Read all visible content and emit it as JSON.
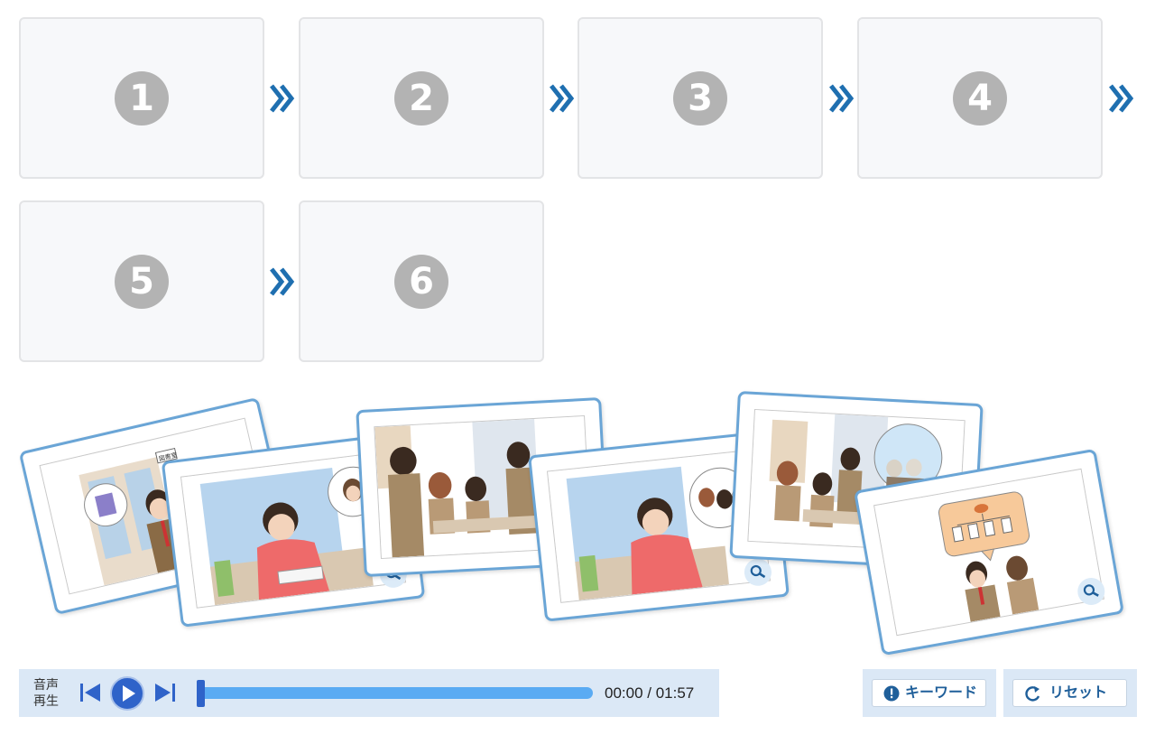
{
  "slots": [
    {
      "number": "1"
    },
    {
      "number": "2"
    },
    {
      "number": "3"
    },
    {
      "number": "4"
    },
    {
      "number": "5"
    },
    {
      "number": "6"
    }
  ],
  "colors": {
    "accent": "#1f6fb0",
    "card_border": "#6aa5d6",
    "player_bg": "#dbe8f6",
    "progress": "#5aabf3",
    "slot_number": "#b3b3b3"
  },
  "cards": [
    {
      "name": "library-scene",
      "has_zoom": true,
      "sign": "図書室"
    },
    {
      "name": "study-desk-scene",
      "has_zoom": true
    },
    {
      "name": "classroom-group-scene",
      "has_zoom": false
    },
    {
      "name": "study-desk-thinking-scene",
      "has_zoom": true
    },
    {
      "name": "classroom-elders-scene",
      "has_zoom": false
    },
    {
      "name": "family-tree-scene",
      "has_zoom": true
    }
  ],
  "player": {
    "label_line1": "音声",
    "label_line2": "再生",
    "current_time": "00:00",
    "total_time": "01:57",
    "time_display": "00:00 / 01:57",
    "progress": 0
  },
  "buttons": {
    "keyword": "キーワード",
    "reset": "リセット"
  }
}
